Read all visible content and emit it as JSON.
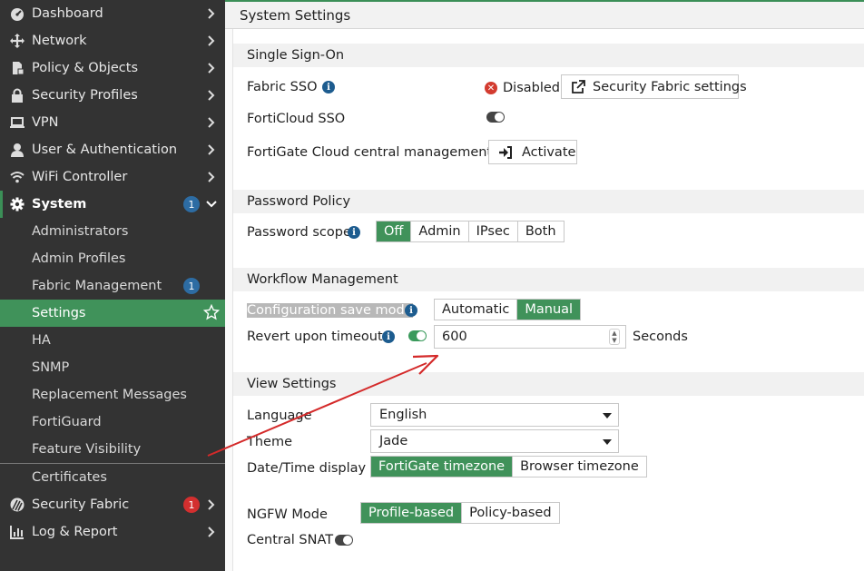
{
  "sidebar": {
    "items": [
      {
        "label": "Dashboard",
        "icon": "dashboard-icon"
      },
      {
        "label": "Network",
        "icon": "network-icon"
      },
      {
        "label": "Policy & Objects",
        "icon": "policy-icon"
      },
      {
        "label": "Security Profiles",
        "icon": "lock-icon"
      },
      {
        "label": "VPN",
        "icon": "laptop-icon"
      },
      {
        "label": "User & Authentication",
        "icon": "user-icon"
      },
      {
        "label": "WiFi Controller",
        "icon": "wifi-icon"
      }
    ],
    "system": {
      "label": "System",
      "badge": "1",
      "icon": "gear-icon"
    },
    "system_sub": [
      {
        "label": "Administrators"
      },
      {
        "label": "Admin Profiles"
      },
      {
        "label": "Fabric Management",
        "badge": "1"
      },
      {
        "label": "Settings",
        "selected": true
      },
      {
        "label": "HA"
      },
      {
        "label": "SNMP"
      },
      {
        "label": "Replacement Messages"
      },
      {
        "label": "FortiGuard"
      },
      {
        "label": "Feature Visibility"
      },
      {
        "label": "Certificates"
      }
    ],
    "bottom": [
      {
        "label": "Security Fabric",
        "badge": "1",
        "icon": "security-fabric-icon"
      },
      {
        "label": "Log & Report",
        "icon": "chart-icon"
      }
    ]
  },
  "header": {
    "title": "System Settings"
  },
  "sso": {
    "section": "Single Sign-On",
    "fabric_sso_label": "Fabric SSO",
    "fabric_sso_status": "Disabled",
    "fabric_button": "Security Fabric settings",
    "forticloud_label": "FortiCloud SSO",
    "fortigate_cloud_label": "FortiGate Cloud central management",
    "activate_button": "Activate"
  },
  "password": {
    "section": "Password Policy",
    "scope_label": "Password scope",
    "options": [
      "Off",
      "Admin",
      "IPsec",
      "Both"
    ],
    "selected": "Off"
  },
  "workflow": {
    "section": "Workflow Management",
    "save_mode_label": "Configuration save mode",
    "save_mode_options": [
      "Automatic",
      "Manual"
    ],
    "save_mode_selected": "Manual",
    "revert_label": "Revert upon timeout",
    "revert_value": "600",
    "revert_unit": "Seconds"
  },
  "view": {
    "section": "View Settings",
    "language_label": "Language",
    "language_value": "English",
    "theme_label": "Theme",
    "theme_value": "Jade",
    "datetime_label": "Date/Time display",
    "datetime_options": [
      "FortiGate timezone",
      "Browser timezone"
    ],
    "datetime_selected": "FortiGate timezone",
    "ngfw_label": "NGFW Mode",
    "ngfw_options": [
      "Profile-based",
      "Policy-based"
    ],
    "ngfw_selected": "Profile-based",
    "snat_label": "Central SNAT"
  },
  "colors": {
    "accent": "#40925a",
    "sidebar": "#333333",
    "annotation": "#d42a2a"
  }
}
